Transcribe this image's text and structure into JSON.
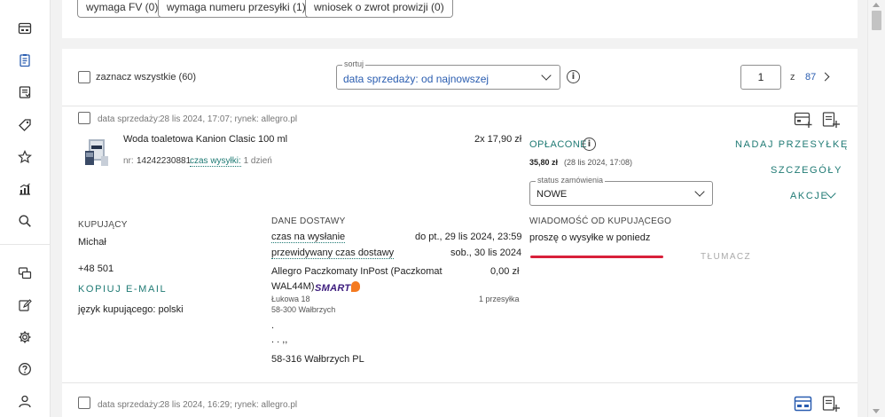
{
  "filters": {
    "chips": [
      "wymaga FV (0)",
      "wymaga numeru przesyłki (1)",
      "wniosek o zwrot prowizji (0)"
    ]
  },
  "toolbar": {
    "select_all_label": "zaznacz wszystkie (60)",
    "sort_legend": "sortuj",
    "sort_value": "data sprzedaży: od najnowszej",
    "page_current": "1",
    "page_of": "z",
    "page_total": "87"
  },
  "order": {
    "meta_label": "data sprzedaży:",
    "meta_value": "28 lis 2024, 17:07; rynek: allegro.pl",
    "product_name": "Woda toaletowa Kanion Clasic 100 ml",
    "quantity_price": "2x 17,90 zł",
    "nr_label": "nr:",
    "nr_value": "14242230881",
    "shipping_time_label": "czas wysyłki:",
    "shipping_time_value": "1 dzień",
    "payment_status": "OPŁACONE",
    "payment_amount": "35,80 zł",
    "payment_date": "(28 lis 2024, 17:08)",
    "status_legend": "status zamówienia",
    "status_value": "NOWE",
    "actions": {
      "send": "NADAJ PRZESYŁKĘ",
      "details": "SZCZEGÓŁY",
      "more": "AKCJE"
    },
    "buyer": {
      "heading": "KUPUJĄCY",
      "name": "Michał",
      "phone": "+48 501",
      "copy_email": "KOPIUJ E-MAIL",
      "language": "język kupującego: polski"
    },
    "delivery": {
      "heading": "DANE DOSTAWY",
      "time_to_send_label": "czas na wysłanie",
      "time_to_send_value": "do pt., 29 lis 2024, 23:59",
      "expected_label": "przewidywany czas dostawy",
      "expected_value": "sob., 30 lis 2024",
      "method_line1": "Allegro Paczkomaty InPost (Paczkomat",
      "method_line2": "WAL44M)",
      "smart_label": "SMART",
      "method_price": "0,00 zł",
      "address_street": "Łukowa 18",
      "address_city": "58-300 Wałbrzych",
      "package_count": "1 przesyłka",
      "recipient_dot": ".",
      "recipient_dots2": ". .  ,,",
      "recipient_city": "58-316 Wałbrzych PL"
    },
    "message": {
      "heading": "WIADOMOŚĆ OD KUPUJĄCEGO",
      "text": "proszę o wysyłke w poniedz",
      "translate": "TŁUMACZ"
    }
  },
  "order2": {
    "meta_label": "data sprzedaży:",
    "meta_value": "28 lis 2024, 16:29; rynek: allegro.pl"
  },
  "colors": {
    "accent": "#1f7a74",
    "link_blue": "#2a5db0",
    "highlight": "#d8203a"
  }
}
